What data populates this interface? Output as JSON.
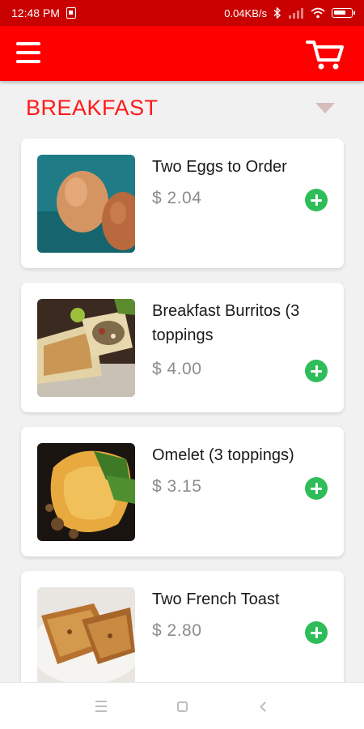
{
  "status_bar": {
    "time": "12:48 PM",
    "network_speed": "0.04KB/s",
    "icons": [
      "sim-card-icon",
      "bluetooth-icon",
      "signal-icon",
      "wifi-icon",
      "battery-icon"
    ]
  },
  "app_bar": {
    "menu_icon": "hamburger-menu-icon",
    "cart_icon": "shopping-cart-icon",
    "color": "#ff0000"
  },
  "category": {
    "label": "BREAKFAST",
    "icon": "dropdown-arrow-icon"
  },
  "menu_items": [
    {
      "name": "Two Eggs to Order",
      "price": "$ 2.04",
      "image": "eggs-photo"
    },
    {
      "name": "Breakfast Burritos (3 toppings",
      "price": "$ 4.00",
      "image": "burrito-photo"
    },
    {
      "name": "Omelet (3 toppings)",
      "price": "$ 3.15",
      "image": "omelet-photo"
    },
    {
      "name": "Two French Toast",
      "price": "$ 2.80",
      "image": "french-toast-photo"
    }
  ],
  "colors": {
    "accent": "#ff0000",
    "status_bar": "#c80000",
    "add_button": "#2ebd59",
    "price_text": "#8c8c8c"
  },
  "nav_bar": {
    "icons": [
      "recent-apps-icon",
      "home-icon",
      "back-icon"
    ]
  }
}
